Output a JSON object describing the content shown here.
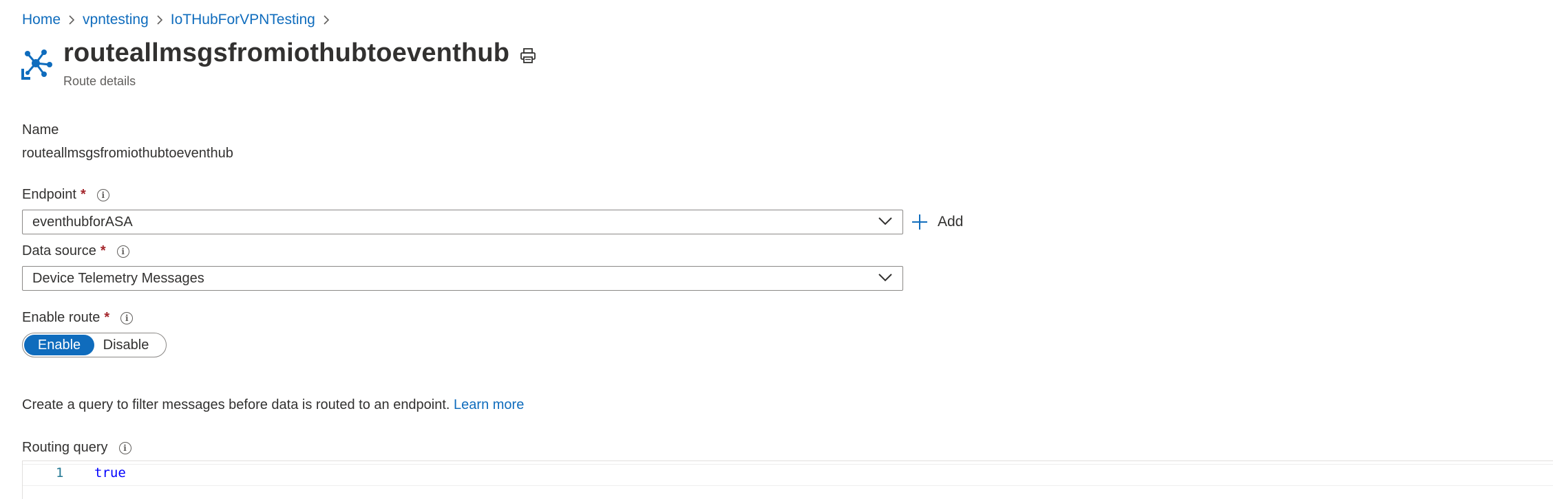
{
  "breadcrumb": {
    "items": [
      {
        "label": "Home"
      },
      {
        "label": "vpntesting"
      },
      {
        "label": "IoTHubForVPNTesting"
      }
    ]
  },
  "header": {
    "title": "routeallmsgsfromiothubtoeventhub",
    "subtitle": "Route details",
    "icon": "iot-routing-icon",
    "print_icon": "print-icon"
  },
  "form": {
    "name": {
      "label": "Name",
      "value": "routeallmsgsfromiothubtoeventhub"
    },
    "endpoint": {
      "label": "Endpoint",
      "required_mark": "*",
      "selected": "eventhubforASA",
      "add_label": "Add"
    },
    "data_source": {
      "label": "Data source",
      "required_mark": "*",
      "selected": "Device Telemetry Messages"
    },
    "enable_route": {
      "label": "Enable route",
      "required_mark": "*",
      "options": [
        "Enable",
        "Disable"
      ],
      "selected": "Enable"
    },
    "query_description": "Create a query to filter messages before data is routed to an endpoint.",
    "learn_more": "Learn more",
    "routing_query": {
      "label": "Routing query",
      "line_number": "1",
      "code": "true"
    }
  },
  "colors": {
    "accent": "#0f6cbd",
    "required": "#a4262c",
    "text": "#323130"
  }
}
